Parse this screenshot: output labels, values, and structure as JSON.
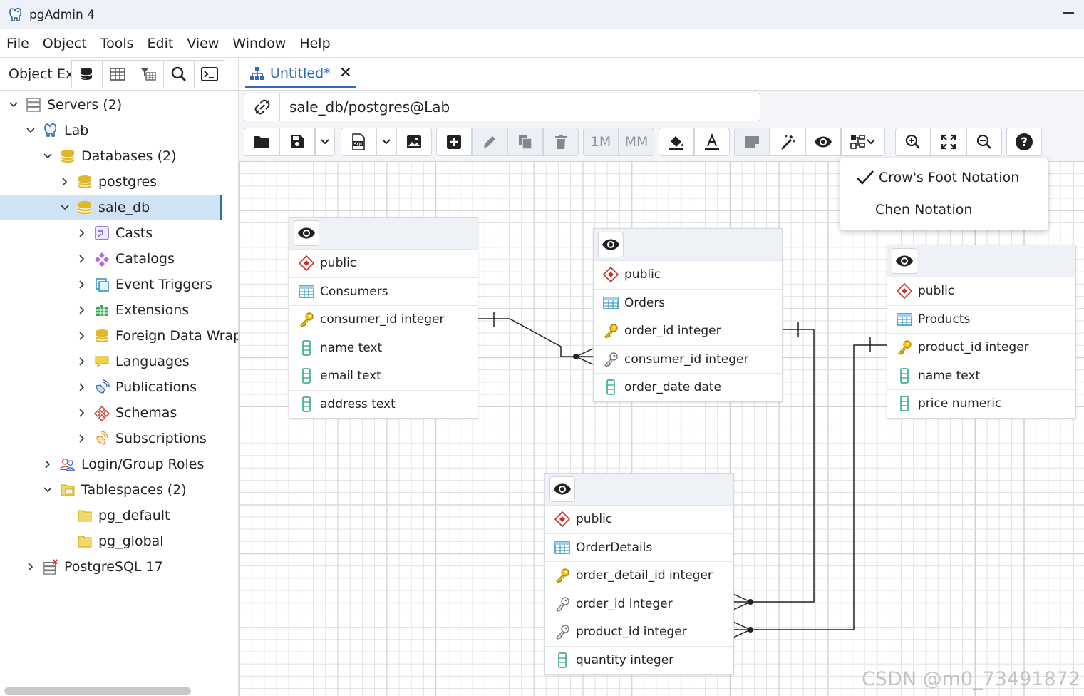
{
  "window": {
    "title": "pgAdmin 4"
  },
  "menu": [
    "File",
    "Object",
    "Tools",
    "Edit",
    "View",
    "Window",
    "Help"
  ],
  "left_panel": {
    "tab_label": "Object Ex",
    "tree": [
      {
        "label": "Servers (2)",
        "icon": "servers-icon"
      },
      {
        "label": "Lab",
        "icon": "postgres-elephant-icon"
      },
      {
        "label": "Databases (2)",
        "icon": "databases-icon"
      },
      {
        "label": "postgres",
        "icon": "database-icon"
      },
      {
        "label": "sale_db",
        "icon": "database-icon"
      },
      {
        "label": "Casts",
        "icon": "casts-icon"
      },
      {
        "label": "Catalogs",
        "icon": "catalogs-icon"
      },
      {
        "label": "Event Triggers",
        "icon": "event-triggers-icon"
      },
      {
        "label": "Extensions",
        "icon": "extensions-icon"
      },
      {
        "label": "Foreign Data Wrappers",
        "icon": "foreign-data-wrappers-icon"
      },
      {
        "label": "Languages",
        "icon": "languages-icon"
      },
      {
        "label": "Publications",
        "icon": "publications-icon"
      },
      {
        "label": "Schemas",
        "icon": "schemas-icon"
      },
      {
        "label": "Subscriptions",
        "icon": "subscriptions-icon"
      },
      {
        "label": "Login/Group Roles",
        "icon": "roles-icon"
      },
      {
        "label": "Tablespaces (2)",
        "icon": "tablespaces-icon"
      },
      {
        "label": "pg_default",
        "icon": "folder-icon"
      },
      {
        "label": "pg_global",
        "icon": "folder-icon"
      },
      {
        "label": "PostgreSQL 17",
        "icon": "server-disconnected-icon"
      }
    ]
  },
  "editor": {
    "tab_label": "Untitled*",
    "connection": "sale_db/postgres@Lab",
    "toolbar": {
      "one_to_many": "1M",
      "many_to_many": "MM"
    },
    "notation_menu": {
      "options": [
        "Crow's Foot Notation",
        "Chen Notation"
      ],
      "checked": "Crow's Foot Notation"
    }
  },
  "tables": {
    "consumers": {
      "schema": "public",
      "name": "Consumers",
      "columns": [
        "consumer_id integer",
        "name text",
        "email text",
        "address text"
      ]
    },
    "orders": {
      "schema": "public",
      "name": "Orders",
      "columns": [
        "order_id integer",
        "consumer_id integer",
        "order_date date"
      ]
    },
    "products": {
      "schema": "public",
      "name": "Products",
      "columns": [
        "product_id integer",
        "name text",
        "price numeric"
      ]
    },
    "orderdetails": {
      "schema": "public",
      "name": "OrderDetails",
      "columns": [
        "order_detail_id integer",
        "order_id integer",
        "product_id integer",
        "quantity integer"
      ]
    }
  },
  "watermark": "CSDN @m0_73491872",
  "colors": {
    "accent": "#2e6ab5",
    "selected_bg": "#cfe3f4",
    "schema_red": "#c9302c",
    "key_yellow": "#d9a300",
    "column_green": "#2aa57a"
  }
}
